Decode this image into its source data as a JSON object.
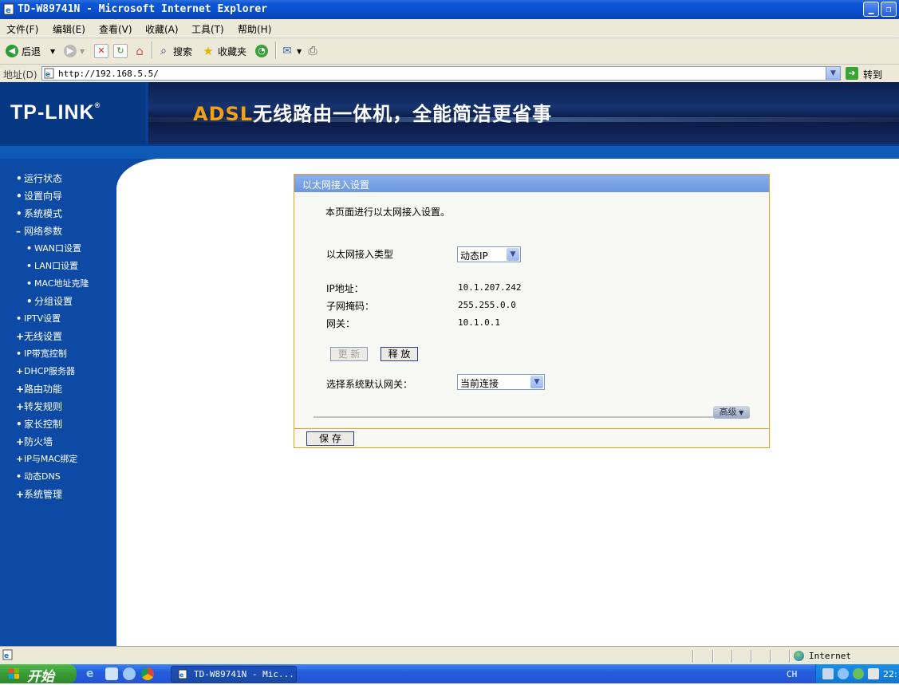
{
  "window": {
    "title": "TD-W89741N - Microsoft Internet Explorer"
  },
  "menu": [
    "文件(F)",
    "编辑(E)",
    "查看(V)",
    "收藏(A)",
    "工具(T)",
    "帮助(H)"
  ],
  "toolbar": {
    "back": "后退",
    "search": "搜索",
    "favorites": "收藏夹"
  },
  "address": {
    "label": "地址(D)",
    "url": "http://192.168.5.5/",
    "go": "转到"
  },
  "header": {
    "logo": "TP-LINK",
    "logo_mark": "®",
    "banner_adsl": "ADSL",
    "banner_rest": "无线路由一体机，全能简洁更省事"
  },
  "sidebar": [
    {
      "label": "运行状态",
      "bullet": "•"
    },
    {
      "label": "设置向导",
      "bullet": "•"
    },
    {
      "label": "系统模式",
      "bullet": "•"
    },
    {
      "label": "网络参数",
      "bullet": "–"
    },
    {
      "label": "WAN口设置",
      "bullet": "•"
    },
    {
      "label": "LAN口设置",
      "bullet": "•"
    },
    {
      "label": "MAC地址克隆",
      "bullet": "•"
    },
    {
      "label": "分组设置",
      "bullet": "•"
    },
    {
      "label": "IPTV设置",
      "bullet": "•"
    },
    {
      "label": "无线设置",
      "bullet": "+"
    },
    {
      "label": "IP带宽控制",
      "bullet": "•"
    },
    {
      "label": "DHCP服务器",
      "bullet": "+"
    },
    {
      "label": "路由功能",
      "bullet": "+"
    },
    {
      "label": "转发规则",
      "bullet": "+"
    },
    {
      "label": "家长控制",
      "bullet": "•"
    },
    {
      "label": "防火墙",
      "bullet": "+"
    },
    {
      "label": "IP与MAC绑定",
      "bullet": "+"
    },
    {
      "label": "动态DNS",
      "bullet": "•"
    },
    {
      "label": "系统管理",
      "bullet": "+"
    }
  ],
  "panel": {
    "title": "以太网接入设置",
    "description": "本页面进行以太网接入设置。",
    "conn_type_label": "以太网接入类型",
    "conn_type_value": "动态IP",
    "ip_label": "IP地址：",
    "ip_value": "10.1.207.242",
    "mask_label": "子网掩码：",
    "mask_value": "255.255.0.0",
    "gw_label": "网关：",
    "gw_value": "10.1.0.1",
    "renew": "更 新",
    "release": "释 放",
    "default_gw_label": "选择系统默认网关：",
    "default_gw_value": "当前连接",
    "advanced": "高级",
    "save": "保 存"
  },
  "statusbar": {
    "zone": "Internet"
  },
  "taskbar": {
    "start": "开始",
    "task": "TD-W89741N - Mic...",
    "lang": "CH",
    "clock": "22:"
  }
}
